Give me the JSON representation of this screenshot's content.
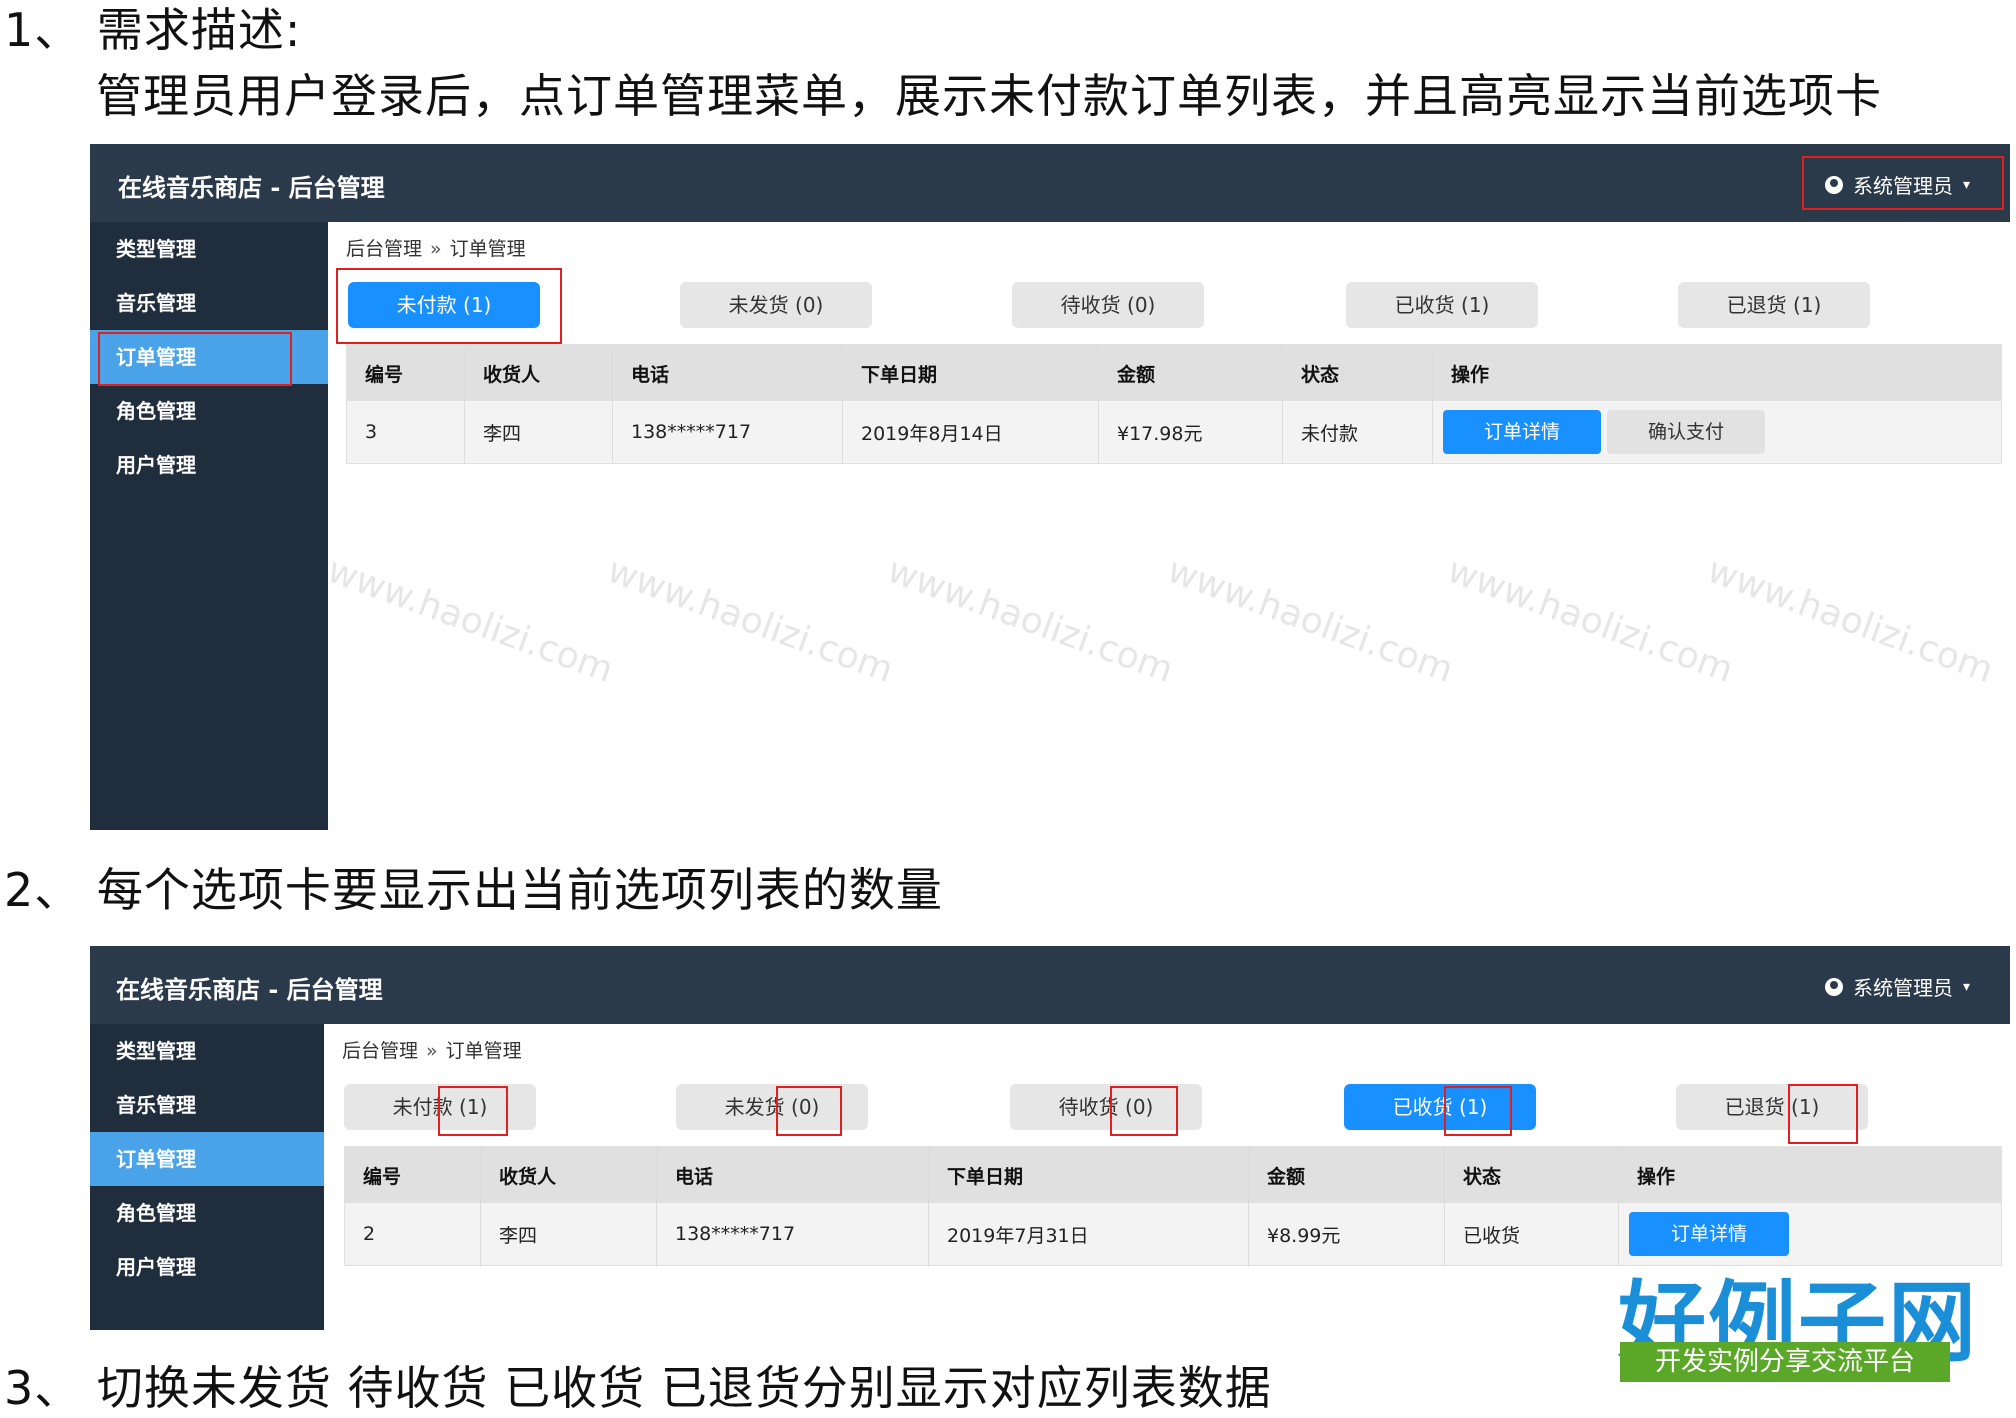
{
  "sections": [
    {
      "number": "1、",
      "title": "需求描述:"
    },
    {
      "subtitle": "管理员用户登录后，点订单管理菜单，展示未付款订单列表，并且高亮显示当前选项卡"
    },
    {
      "number": "2、",
      "title": "每个选项卡要显示出当前选项列表的数量"
    },
    {
      "number": "3、",
      "title": "切换未发货 待收货 已收货 已退货分别显示对应列表数据"
    }
  ],
  "app": {
    "title": "在线音乐商店 - 后台管理",
    "user": "系统管理员",
    "sidebar": [
      "类型管理",
      "音乐管理",
      "订单管理",
      "角色管理",
      "用户管理"
    ],
    "breadcrumb": {
      "root": "后台管理",
      "sep": "»",
      "current": "订单管理"
    },
    "tabs": [
      "未付款 (1)",
      "未发货 (0)",
      "待收货 (0)",
      "已收货 (1)",
      "已退货 (1)"
    ],
    "columns": [
      "编号",
      "收货人",
      "电话",
      "下单日期",
      "金额",
      "状态",
      "操作"
    ]
  },
  "screen1": {
    "active_tab_index": 0,
    "row": {
      "id": "3",
      "receiver": "李四",
      "phone": "138*****717",
      "date": "2019年8月14日",
      "amount": "¥17.98元",
      "status": "未付款"
    },
    "actions": [
      "订单详情",
      "确认支付"
    ]
  },
  "screen2": {
    "active_tab_index": 3,
    "row": {
      "id": "2",
      "receiver": "李四",
      "phone": "138*****717",
      "date": "2019年7月31日",
      "amount": "¥8.99元",
      "status": "已收货"
    },
    "actions": [
      "订单详情"
    ]
  },
  "watermark": "www.haolizi.com",
  "logo": {
    "main": "好例子网",
    "sub": "开发实例分享交流平台"
  }
}
